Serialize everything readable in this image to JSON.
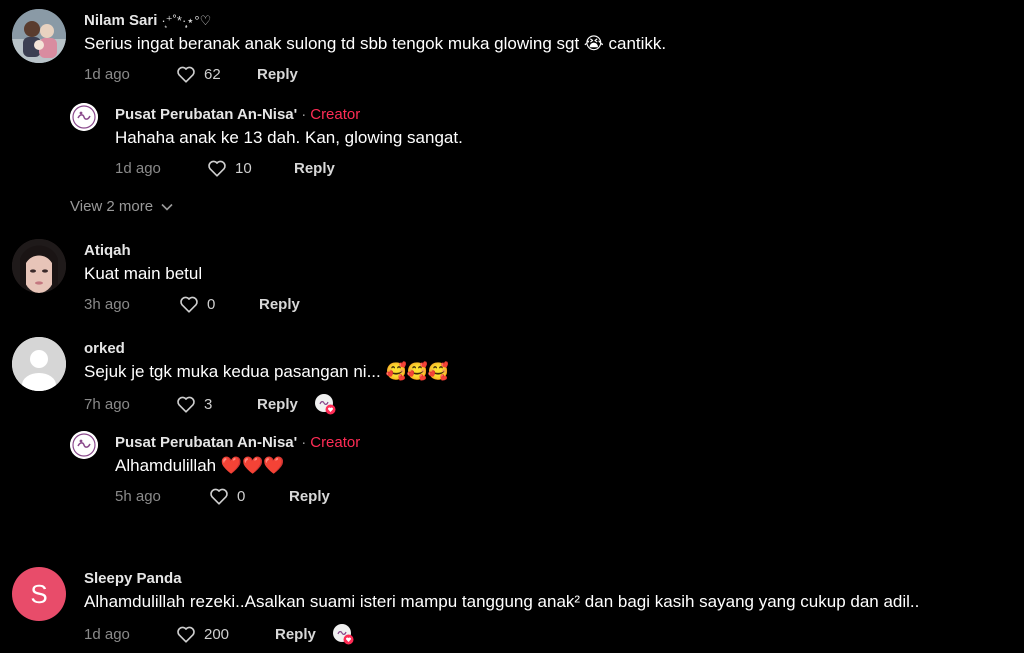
{
  "colors": {
    "background": "#000000",
    "creator_tag": "#fe2c55",
    "meta_gray": "#8a8a8a",
    "avatar_s_bg": "#e84c6a"
  },
  "comments": [
    {
      "username": "Nilam Sari",
      "username_deco": "·͙⁺˚*·̩̩͙⋆°♡",
      "text": "Serius ingat beranak anak sulong td sbb tengok muka glowing sgt 😭 cantikk.",
      "time": "1d ago",
      "likes": "62",
      "reply_label": "Reply",
      "avatar_icon": "profile-photo-couple"
    },
    {
      "username": "Pusat Perubatan An-Nisa'",
      "separator": "·",
      "creator_label": "Creator",
      "text": "Hahaha anak ke 13 dah. Kan, glowing sangat.",
      "time": "1d ago",
      "likes": "10",
      "reply_label": "Reply",
      "avatar_icon": "clinic-logo"
    },
    {
      "username": "Atiqah",
      "text": "Kuat main betul",
      "time": "3h ago",
      "likes": "0",
      "reply_label": "Reply",
      "avatar_icon": "profile-photo-woman"
    },
    {
      "username": "orked",
      "text": "Sejuk je tgk muka kedua pasangan ni... 🥰🥰🥰",
      "time": "7h ago",
      "likes": "3",
      "reply_label": "Reply",
      "avatar_icon": "default-avatar",
      "has_creator_liked": true
    },
    {
      "username": "Pusat Perubatan An-Nisa'",
      "separator": "·",
      "creator_label": "Creator",
      "text": "Alhamdulillah ❤️❤️❤️",
      "time": "5h ago",
      "likes": "0",
      "reply_label": "Reply",
      "avatar_icon": "clinic-logo"
    },
    {
      "username": "Sleepy Panda",
      "text": "Alhamdulillah rezeki..Asalkan suami isteri mampu tanggung anak² dan bagi kasih sayang yang cukup dan adil..",
      "time": "1d ago",
      "likes": "200",
      "reply_label": "Reply",
      "avatar_letter": "S",
      "avatar_icon": "letter-avatar",
      "has_creator_liked": true
    }
  ],
  "view_more_label": "View 2 more"
}
